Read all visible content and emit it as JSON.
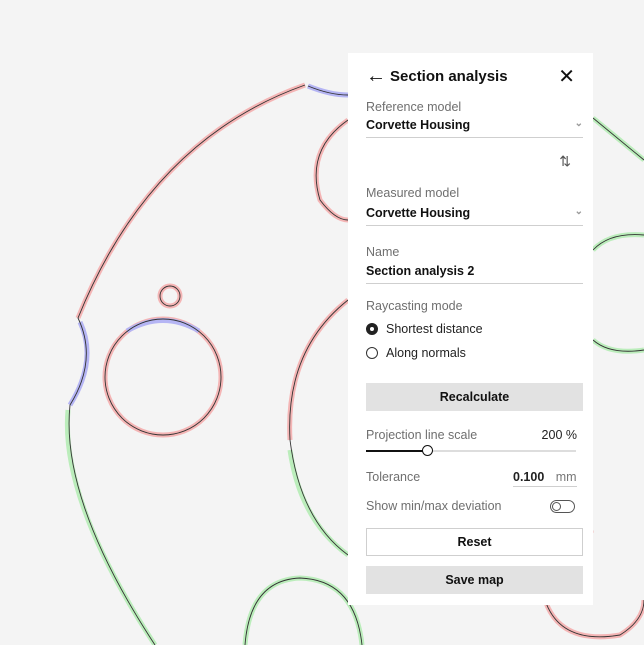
{
  "panel": {
    "title": "Section analysis",
    "back_icon": "arrow-left-icon",
    "close_icon": "close-icon",
    "reference_model": {
      "label": "Reference model",
      "value": "Corvette Housing"
    },
    "swap_icon": "swap-vertical-icon",
    "measured_model": {
      "label": "Measured model",
      "value": "Corvette Housing"
    },
    "name": {
      "label": "Name",
      "value": "Section analysis 2"
    },
    "raycasting": {
      "label": "Raycasting mode",
      "options": [
        {
          "label": "Shortest distance",
          "selected": true
        },
        {
          "label": "Along normals",
          "selected": false
        }
      ]
    },
    "recalculate_label": "Recalculate",
    "projection": {
      "label": "Projection line scale",
      "value_text": "200 %",
      "fraction": 0.29
    },
    "tolerance": {
      "label": "Tolerance",
      "value": "0.100",
      "unit": "mm"
    },
    "show_minmax": {
      "label": "Show min/max deviation",
      "on": false
    },
    "reset_label": "Reset",
    "save_label": "Save map"
  },
  "deviation_colors": {
    "over": "#f08a8a",
    "under": "#8a8af0",
    "in_tolerance": "#9be89b",
    "near": "#f5d08a",
    "cyan": "#8ae6f0"
  }
}
